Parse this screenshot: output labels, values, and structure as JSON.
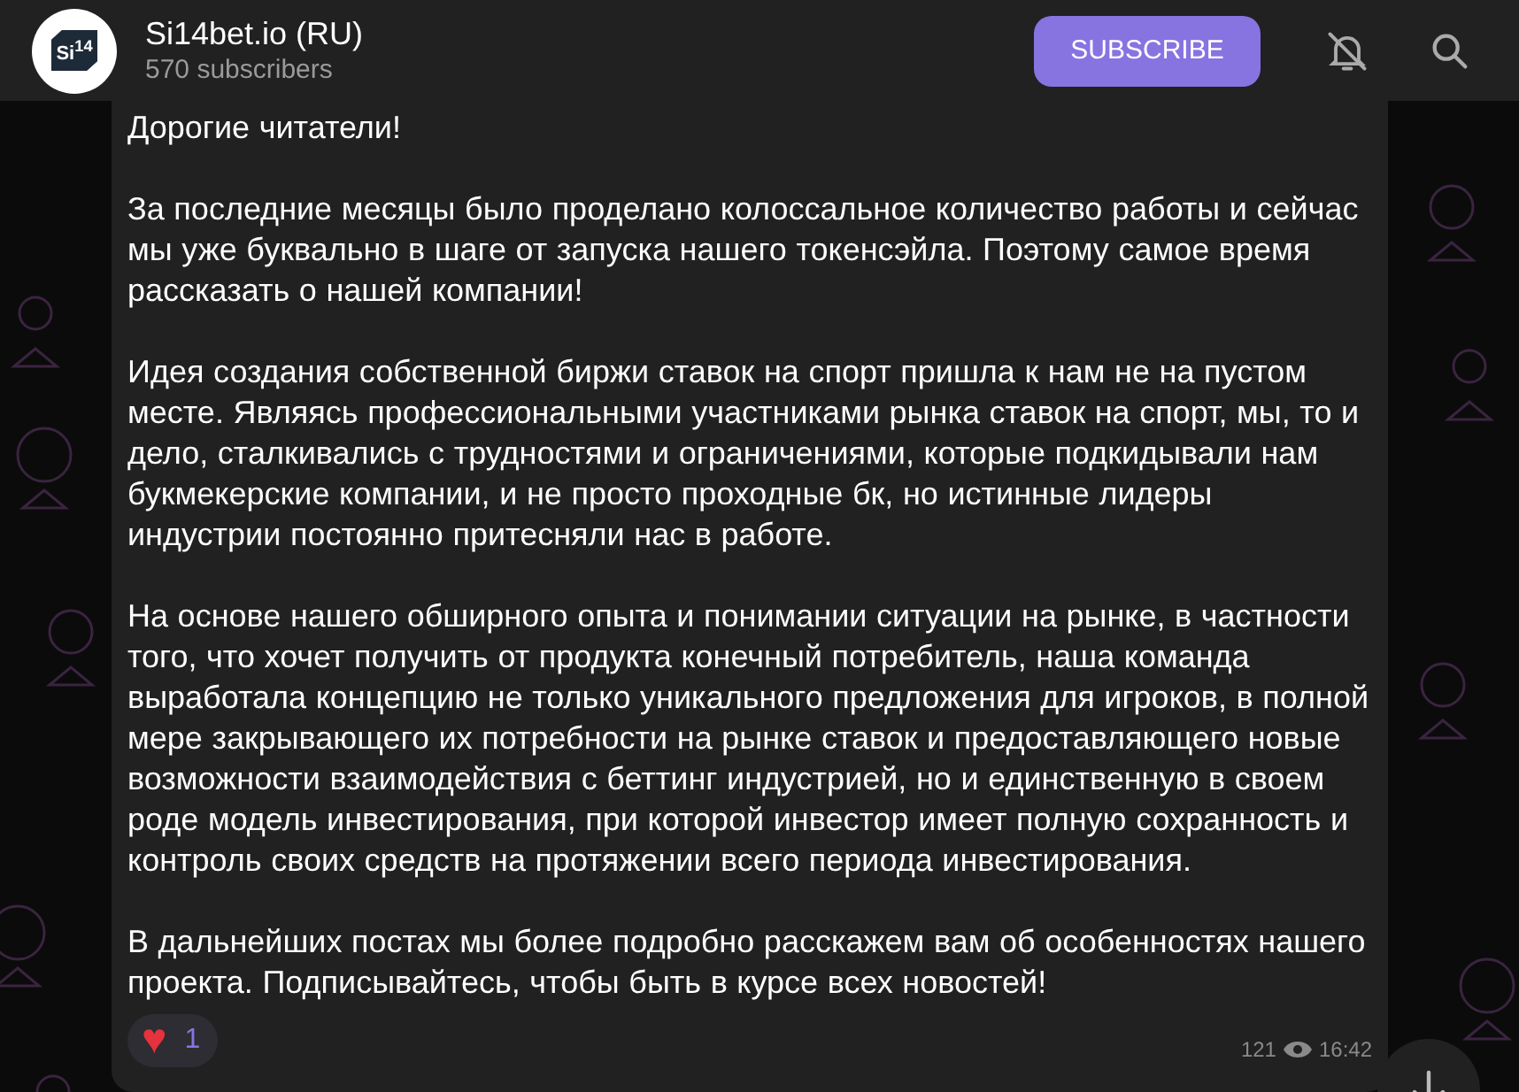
{
  "channel": {
    "logo_text": "Si$^{14}$",
    "title": "Si14bet.io (RU)",
    "subscribers": "570 subscribers"
  },
  "header_actions": {
    "subscribe": "SUBSCRIBE",
    "notifications_muted": true
  },
  "message": {
    "paragraphs": [
      "Дорогие читатели!",
      "За последние месяцы было проделано колоссальное количество работы и сейчас мы уже буквально в шаге от запуска нашего токенсэйла. Поэтому самое время рассказать о нашей компании!",
      "Идея создания собственной биржи ставок на спорт пришла к нам не на пустом месте. Являясь профессиональными участниками рынка ставок на спорт, мы, то и дело, сталкивались с трудностями и ограничениями, которые подкидывали нам букмекерские компании, и не просто проходные бк, но истинные лидеры индустрии постоянно притесняли нас в работе.",
      "На основе нашего обширного опыта и понимании ситуации на рынке, в частности того, что хочет получить от продукта конечный потребитель, наша команда выработала концепцию не только уникального предложения для игроков, в полной мере закрывающего их потребности на рынке ставок и предоставляющего новые возможности взаимодействия с беттинг индустрией, но и единственную в своем роде модель инвестирования, при которой инвестор имеет полную сохранность и контроль своих средств на протяжении всего периода инвестирования.",
      "В дальнейших постах мы более подробно расскажем вам об особенностях нашего проекта. Подписывайтесь, чтобы быть в курсе всех новостей!"
    ],
    "reactions": [
      {
        "emoji": "♥",
        "count": "1"
      }
    ],
    "views": "121",
    "time": "16:42"
  }
}
